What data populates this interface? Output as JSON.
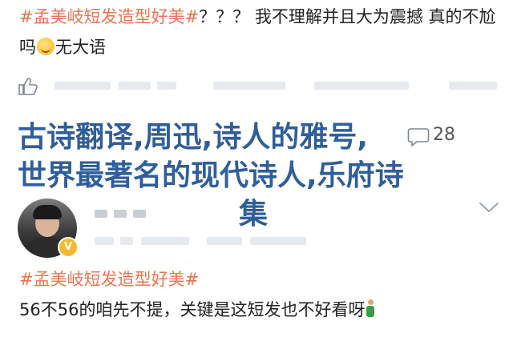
{
  "post1": {
    "hashtag": "#孟美岐短发造型好美#",
    "text_after_tag": "？？？ 我不理解并且大为震撼 真的不尬吗",
    "text_after_emoji": "无大语",
    "emoji_icon": "grimacing-face-icon"
  },
  "overlay": {
    "line1": "古诗翻译,周迅,诗人的雅号,",
    "line2": "世界最著名的现代诗人,乐府诗",
    "line3": "集",
    "color": "#2f5e9a"
  },
  "actions": {
    "like_icon": "thumbs-up-icon",
    "comment_icon": "comment-icon",
    "comment_count": "28"
  },
  "comment": {
    "avatar_icon": "avatar",
    "verified_icon": "verified-badge-icon",
    "verified_glyph": "V",
    "expand_icon": "chevron-down-icon",
    "hashtag": "#孟美岐短发造型好美#",
    "body": "56不56的咱先不提，关键是这短发也不好看呀",
    "emoji_icon": "person-kneeling-icon"
  },
  "colors": {
    "hashtag": "#eb7350",
    "text": "#222222"
  }
}
